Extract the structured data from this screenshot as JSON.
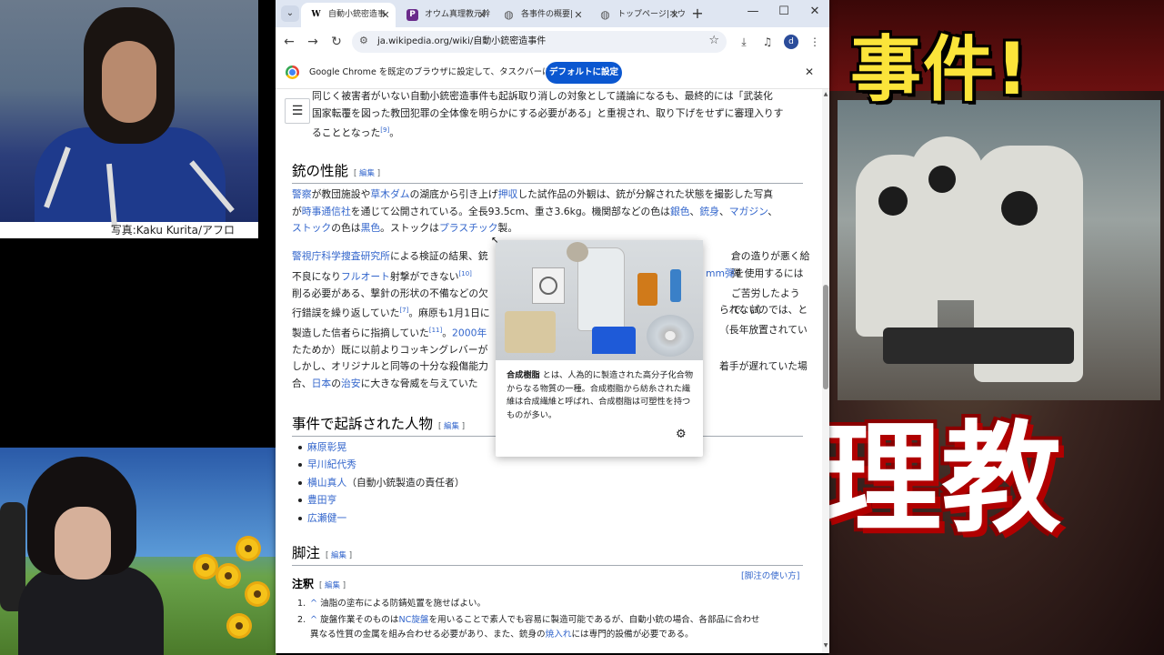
{
  "stream": {
    "photo_caption": "写真:Kaku Kurita/アフロ",
    "thumbnail_title_top": "事件!",
    "thumbnail_title_bottom": "理教"
  },
  "browser": {
    "tabs": [
      {
        "label": "自動小銃密造事",
        "favicon": "W",
        "active": true
      },
      {
        "label": "オウム真理教元幹",
        "favicon": "P",
        "active": false
      },
      {
        "label": "各事件の概要|",
        "favicon": "globe-icon",
        "active": false
      },
      {
        "label": "トップページ|オウ",
        "favicon": "globe-icon",
        "active": false
      }
    ],
    "url": "ja.wikipedia.org/wiki/自動小銃密造事件",
    "avatar_initial": "d",
    "infobar": {
      "text": "Google Chrome を既定のブラウザに設定して、タスクバーに固定する",
      "button": "デフォルトに設定"
    }
  },
  "article": {
    "intro": {
      "text_a": "同じく被害者がいない自動小銃密造事件も起訴取り消しの対象として議論になるも、最終的には「武装化",
      "text_b": "国家転覆を図った教団犯罪の全体像を明らかにする必要がある」と重視され、取り下げをせずに審理入りす",
      "text_c": "ることとなった",
      "ref": "[9]",
      "text_d": "。"
    },
    "section_performance": {
      "heading": "銃の性能",
      "edit": "編集",
      "p1": {
        "a": "警察",
        "b": "が教団施設や",
        "c": "草木ダム",
        "d": "の湖底から引き上げ",
        "e": "押収",
        "f": "した試作品の外観は、銃が分解された状態を撮影した写真",
        "g": "が",
        "h": "時事通信社",
        "i": "を通じて公開されている。全長93.5cm、重さ3.6kg。機関部などの色は",
        "j": "銀色",
        "k": "、",
        "l": "銃身",
        "m": "、",
        "n": "マガジン",
        "o": "、",
        "p": "ストック",
        "q": "の色は",
        "r": "黒色",
        "s": "。ストックは",
        "t": "プラスチック",
        "u": "製。"
      },
      "p2": {
        "l1a": "警視庁科学捜査研究所",
        "l1b": "による検証の結果、銃",
        "l1c": "倉の造りが悪く給弾",
        "l2a": "不良になり",
        "l2b": "フルオート",
        "l2c": "射撃ができない",
        "l2d": "[10]",
        "l2e": "mm弾",
        "l2f": "を使用するには",
        "l3a": "削る必要がある、撃針の形状の不備などの欠",
        "l3b": "ご苦労したようで、試",
        "l4a": "行錯誤を繰り返していた",
        "l4b": "[7]",
        "l4c": "。麻原も1月1日に",
        "l4d": "られないのでは、と",
        "l5a": "製造した信者らに指摘していた",
        "l5b": "[11]",
        "l5c": "。",
        "l5d": "2000年",
        "l5e": "（長年放置されてい",
        "l6a": "たためか）既に以前よりコッキングレバーが"
      },
      "p3": {
        "l1a": "しかし、オリジナルと同等の十分な殺傷能力",
        "l1b": "着手が遅れていた場",
        "l2a": "合、",
        "l2b": "日本",
        "l2c": "の",
        "l2d": "治安",
        "l2e": "に大きな脅威を与えていた"
      }
    },
    "section_defendants": {
      "heading": "事件で起訴された人物",
      "edit": "編集",
      "people": [
        {
          "name": "麻原彰晃",
          "note": ""
        },
        {
          "name": "早川紀代秀",
          "note": ""
        },
        {
          "name": "横山真人",
          "note": "（自動小銃製造の責任者）"
        },
        {
          "name": "豊田亨",
          "note": ""
        },
        {
          "name": "広瀬健一",
          "note": ""
        }
      ]
    },
    "section_footnotes": {
      "heading": "脚注",
      "edit": "編集",
      "usage_link": "[脚注の使い方]",
      "sub_heading": "注釈",
      "sub_edit": "編集",
      "notes": [
        {
          "num": "1.",
          "caret": "^",
          "text": "油脂の塗布による防錆処置を施せばよい。"
        },
        {
          "num": "2.",
          "caret": "^",
          "a": "旋盤作業そのものは",
          "b": "NC旋盤",
          "c": "を用いることで素人でも容易に製造可能であるが、自動小銃の場合、各部品に合わせ",
          "d": "異なる性質の金属を組み合わせる必要があり、また、銃身の",
          "e": "焼入れ",
          "f": "には専門的設備が必要である。"
        }
      ]
    },
    "popup": {
      "term": "合成樹脂",
      "text": " とは、人為的に製造された高分子化合物からなる物質の一種。合成樹脂から紡糸された繊維は合成繊維と呼ばれ、合成樹脂は可塑性を持つものが多い。"
    }
  },
  "colors": {
    "link": "#3366cc",
    "button": "#0b57d0",
    "tabstrip": "#dfe6f2"
  }
}
